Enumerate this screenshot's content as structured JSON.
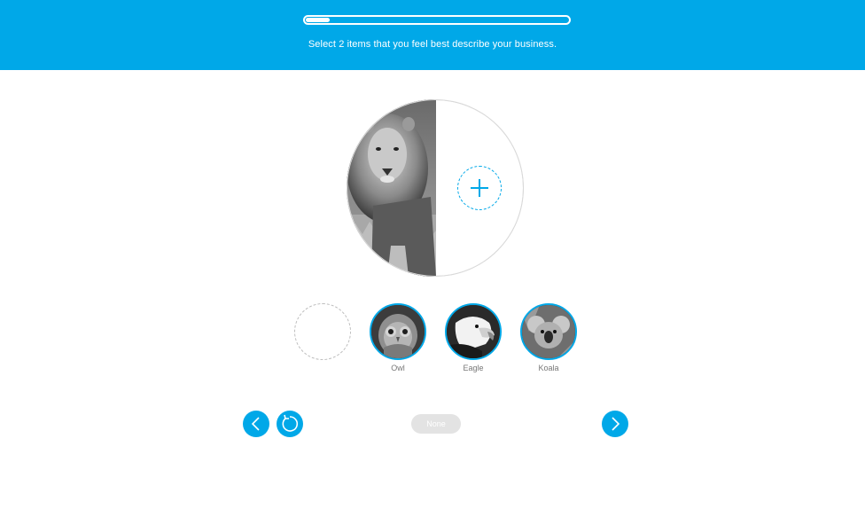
{
  "header": {
    "progress_fraction": 0.09,
    "instruction": "Select 2 items that you feel best describe your business."
  },
  "selection": {
    "selected_animal": "Lion",
    "add_slot_icon": "plus-icon"
  },
  "options": [
    {
      "label": "Owl",
      "icon": "owl-image"
    },
    {
      "label": "Eagle",
      "icon": "eagle-image"
    },
    {
      "label": "Koala",
      "icon": "koala-image"
    }
  ],
  "controls": {
    "back_icon": "chevron-left-icon",
    "reset_icon": "reset-icon",
    "none_label": "None",
    "next_icon": "chevron-right-icon"
  },
  "colors": {
    "accent": "#00a8e8",
    "disabled": "#e3e3e3"
  }
}
